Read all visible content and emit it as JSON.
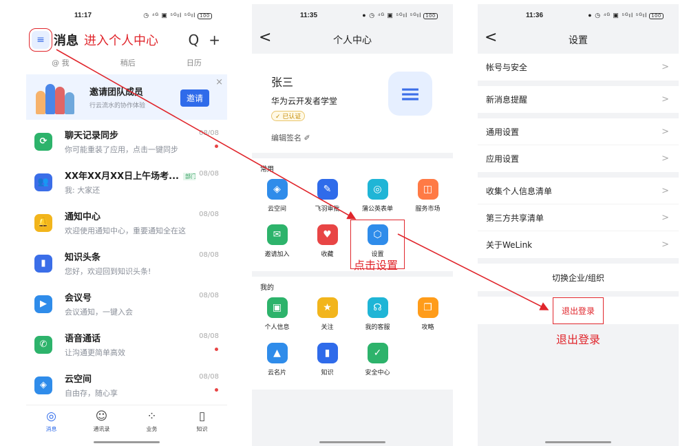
{
  "colors": {
    "accent": "#2f6bea",
    "annotation": "#e0252b"
  },
  "phone1": {
    "status": {
      "time": "11:17",
      "icons": "◷ ⁴ᴳ ▣ ⁵ᴳıl ⁵ᴳıl",
      "battery": "100"
    },
    "menu_icon": "≡",
    "title": "消息",
    "annotation": "进入个人中心",
    "actions": {
      "search": "Q",
      "add": "+"
    },
    "tabs": [
      "@ 我",
      "稍后",
      "日历"
    ],
    "banner": {
      "title": "邀请团队成员",
      "subtitle": "行云流水的协作体验",
      "button": "邀请",
      "close": "×"
    },
    "messages": [
      {
        "title": "聊天记录同步",
        "subtitle": "你可能重装了应用，点击一键同步",
        "date": "08/08",
        "dot": true,
        "color": "#2db36b",
        "icon": "⟳"
      },
      {
        "title": "XX年XX月XX日上午场考...",
        "tag": "部门",
        "subtitle": "我: 大家还",
        "date": "08/08",
        "dot": false,
        "color": "#3b6ee8",
        "icon": "👥"
      },
      {
        "title": "通知中心",
        "subtitle": "欢迎使用通知中心，重要通知全在这",
        "date": "08/08",
        "dot": false,
        "color": "#f2b51c",
        "icon": "🔔"
      },
      {
        "title": "知识头条",
        "subtitle": "您好，欢迎回到知识头条!",
        "date": "08/08",
        "dot": false,
        "color": "#3b6ee8",
        "icon": "▮"
      },
      {
        "title": "会议号",
        "subtitle": "会议通知，一键入会",
        "date": "08/08",
        "dot": false,
        "color": "#2f8cea",
        "icon": "▶"
      },
      {
        "title": "语音通话",
        "subtitle": "让沟通更简单高效",
        "date": "08/08",
        "dot": true,
        "color": "#2db36b",
        "icon": "✆"
      },
      {
        "title": "云空间",
        "subtitle": "自由存，随心享",
        "date": "08/08",
        "dot": true,
        "color": "#2f8cea",
        "icon": "◈"
      }
    ],
    "bottom_nav": [
      {
        "label": "消息",
        "icon": "◎",
        "active": true
      },
      {
        "label": "通讯录",
        "icon": "☺",
        "active": false
      },
      {
        "label": "业务",
        "icon": "⁘",
        "active": false
      },
      {
        "label": "知识",
        "icon": "▯",
        "active": false
      }
    ]
  },
  "phone2": {
    "status": {
      "time": "11:35",
      "icons": "● ◷ ⁴ᴳ ▣ ⁵ᴳıl ⁵ᴳıl",
      "battery": "100"
    },
    "back": "<",
    "title": "个人中心",
    "profile": {
      "name": "张三",
      "org": "华为云开发者学堂",
      "badge": "✓ 已认证",
      "signature": "编辑签名 ✐",
      "avatar": "≡"
    },
    "common_title": "常用",
    "common": [
      {
        "label": "云空间",
        "color": "#2f8cea",
        "icon": "◈"
      },
      {
        "label": "飞羽审批",
        "color": "#2f6bea",
        "icon": "✎"
      },
      {
        "label": "蒲公英表单",
        "color": "#1fb5d6",
        "icon": "◎"
      },
      {
        "label": "服务市场",
        "color": "#ff7a45",
        "icon": "◫"
      },
      {
        "label": "邀请加入",
        "color": "#2db36b",
        "icon": "✉"
      },
      {
        "label": "收藏",
        "color": "#e84545",
        "icon": "♥"
      },
      {
        "label": "设置",
        "color": "#2f8cea",
        "icon": "⬡"
      }
    ],
    "annotation": "点击设置",
    "mine_title": "我的",
    "mine": [
      {
        "label": "个人信息",
        "color": "#2db36b",
        "icon": "▣"
      },
      {
        "label": "关注",
        "color": "#f2b51c",
        "icon": "★"
      },
      {
        "label": "我的客服",
        "color": "#1fb5d6",
        "icon": "☊"
      },
      {
        "label": "攻略",
        "color": "#ff9c1a",
        "icon": "❐"
      },
      {
        "label": "云名片",
        "color": "#2f8cea",
        "icon": "▲"
      },
      {
        "label": "知识",
        "color": "#2f6bea",
        "icon": "▮"
      },
      {
        "label": "安全中心",
        "color": "#2db36b",
        "icon": "✓"
      }
    ]
  },
  "phone3": {
    "status": {
      "time": "11:36",
      "icons": "● ◷ ⁴ᴳ ▣ ⁵ᴳıl ⁵ᴳıl",
      "battery": "100"
    },
    "back": "<",
    "title": "设置",
    "groups": [
      [
        "帐号与安全"
      ],
      [
        "新消息提醒"
      ],
      [
        "通用设置",
        "应用设置"
      ],
      [
        "收集个人信息清单",
        "第三方共享清单",
        "关于WeLink"
      ]
    ],
    "chevron": ">",
    "switch_org": "切换企业/组织",
    "logout": "退出登录",
    "annotation": "退出登录"
  }
}
